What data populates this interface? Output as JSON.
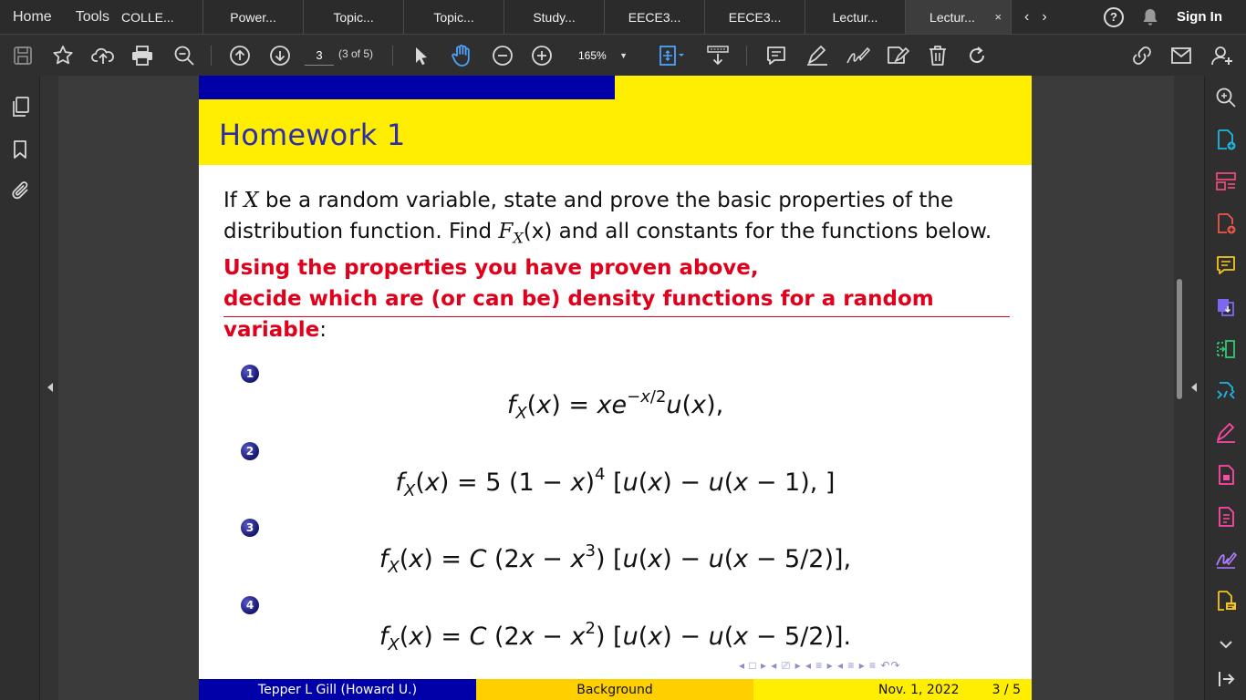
{
  "tabbar": {
    "home": "Home",
    "tools": "Tools",
    "tabs": [
      {
        "label": "COLLE..."
      },
      {
        "label": "Power..."
      },
      {
        "label": "Topic..."
      },
      {
        "label": "Topic..."
      },
      {
        "label": "Study..."
      },
      {
        "label": "EECE3..."
      },
      {
        "label": "EECE3..."
      },
      {
        "label": "Lectur..."
      },
      {
        "label": "Lectur..."
      }
    ],
    "close_glyph": "×",
    "help_glyph": "?",
    "sign_in": "Sign In"
  },
  "toolbar": {
    "page_number": "3",
    "page_of": "(3 of 5)",
    "zoom": "165%"
  },
  "slide": {
    "title": "Homework 1",
    "para": [
      "If ",
      "X",
      " be a random variable, state and prove the basic properties of the distribution function. Find ",
      "F",
      "X",
      "(x)",
      " and all constants for the functions below."
    ],
    "red_line1": "Using the properties you have proven above,",
    "red_line2": "decide which are (or can be) density functions for a random variable",
    "red_colon": ":",
    "items": [
      {
        "num": "1",
        "formula": "fX(x) = xe−x/2u(x),"
      },
      {
        "num": "2",
        "formula": "fX(x) = 5 (1 − x)4 [u(x) − u(x − 1), ]"
      },
      {
        "num": "3",
        "formula": "fX(x) = C (2x − x3) [u(x) − u(x − 5/2)],"
      },
      {
        "num": "4",
        "formula": "fX(x) = C (2x − x2) [u(x) − u(x − 5/2)]."
      }
    ],
    "beamer_nav": "◂ □ ▸ ◂ ⎚ ▸ ◂ ≡ ▸ ◂ ≡ ▸    ≡    ↶↷",
    "footer_author": "Tepper L Gill  (Howard U.)",
    "footer_section": "Background",
    "footer_date": "Nov. 1, 2022",
    "footer_page": "3 / 5"
  },
  "colors": {
    "beamer_yellow": "#ffee00",
    "beamer_blue": "#0000a8",
    "alert_red": "#e0001b",
    "title_blue": "#2e2eaa"
  }
}
